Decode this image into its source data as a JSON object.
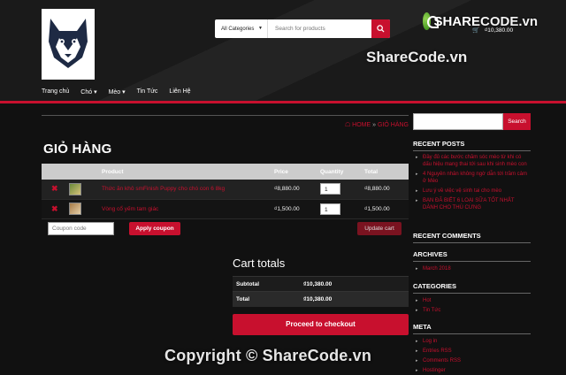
{
  "header": {
    "search": {
      "category": "All Categories",
      "placeholder": "Search for products"
    },
    "cart_total": "₫10,380.00",
    "nav": [
      "Trang chủ",
      "Chó",
      "Mèo",
      "Tin Tức",
      "Liên Hệ"
    ],
    "nav_dropdown": [
      false,
      true,
      true,
      false,
      false
    ]
  },
  "watermark": {
    "logo_share": "SHARE",
    "logo_code": "CODE.vn",
    "text": "ShareCode.vn",
    "copyright": "Copyright © ShareCode.vn"
  },
  "breadcrumb": {
    "home": "HOME",
    "separator": "»",
    "current": "GIỎ HÀNG"
  },
  "page_title": "GIỎ HÀNG",
  "cart": {
    "headers": [
      "Product",
      "Price",
      "Quantity",
      "Total"
    ],
    "rows": [
      {
        "name": "Thức ăn khô smFinish Puppy cho chó con 6 8kg",
        "price": "₫8,880.00",
        "qty": "1",
        "total": "₫8,880.00"
      },
      {
        "name": "Vòng cổ yếm tam giác",
        "price": "₫1,500.00",
        "qty": "1",
        "total": "₫1,500.00"
      }
    ],
    "coupon_placeholder": "Coupon code",
    "apply_label": "Apply coupon",
    "update_label": "Update cart"
  },
  "totals": {
    "title": "Cart totals",
    "subtotal_label": "Subtotal",
    "subtotal_value": "₫10,380.00",
    "total_label": "Total",
    "total_value": "₫10,380.00",
    "checkout_label": "Proceed to checkout"
  },
  "sidebar": {
    "search_button": "Search",
    "recent_posts_title": "RECENT POSTS",
    "recent_posts": [
      "Đầy đủ các bước chăm sóc mèo từ khi có dấu hiệu mang thai tới sau khi sinh mèo con",
      "4 Nguyên nhân không ngờ dẫn tới trầm cảm ở Mèo",
      "Lưu ý về việc vệ sinh tai cho mèo",
      "BẠN ĐÃ BIẾT 6 LOẠI SỮA TỐT NHẤT DÀNH CHO THÚ CƯNG"
    ],
    "recent_comments_title": "RECENT COMMENTS",
    "archives_title": "ARCHIVES",
    "archives": [
      "March 2018"
    ],
    "categories_title": "CATEGORIES",
    "categories": [
      "Hot",
      "Tin Tức"
    ],
    "meta_title": "META",
    "meta": [
      "Log in",
      "Entries RSS",
      "Comments RSS",
      "Hostinger"
    ]
  },
  "colors": {
    "accent": "#c8102e",
    "background": "#111111"
  }
}
